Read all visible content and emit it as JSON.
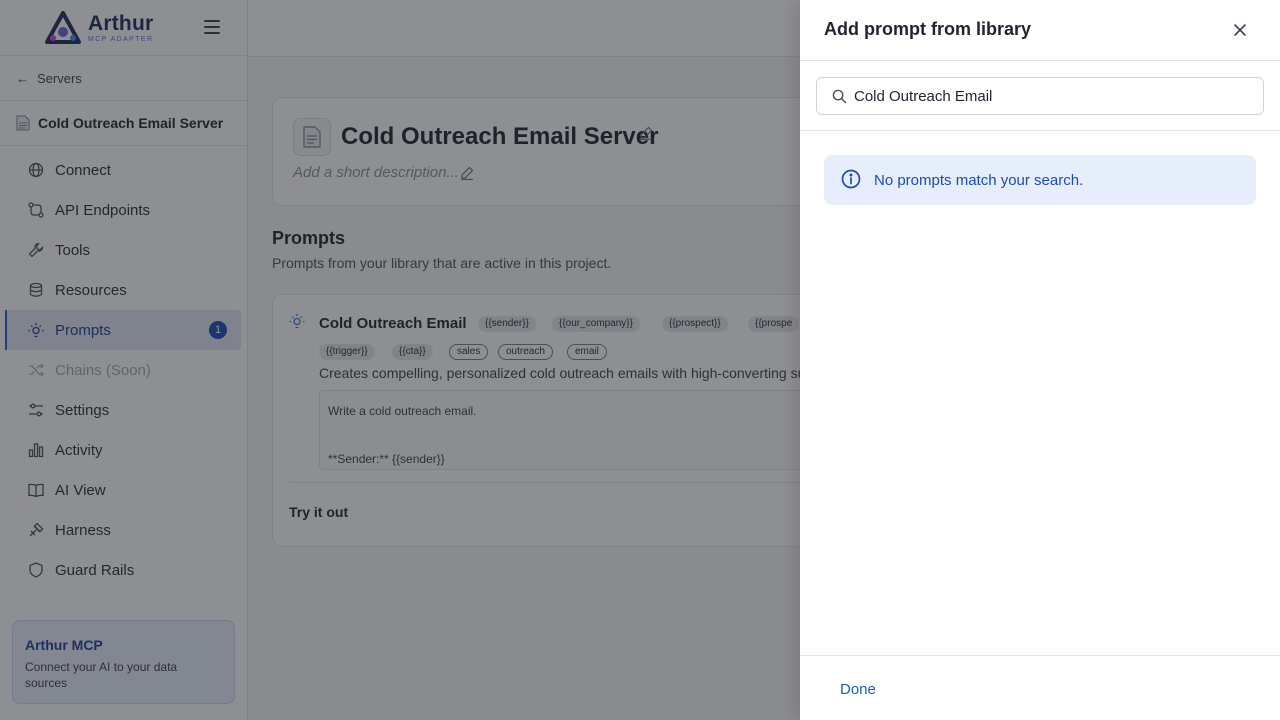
{
  "brand": {
    "name": "Arthur",
    "subtitle": "MCP ADAPTER",
    "accent": "#1e4bb8"
  },
  "sidebar": {
    "back_label": "Servers",
    "server_name": "Cold Outreach Email Server",
    "items": [
      {
        "label": "Connect",
        "icon": "globe-icon"
      },
      {
        "label": "API Endpoints",
        "icon": "endpoints-icon"
      },
      {
        "label": "Tools",
        "icon": "wrench-icon"
      },
      {
        "label": "Resources",
        "icon": "database-icon"
      },
      {
        "label": "Prompts",
        "icon": "bulb-icon",
        "badge": "1",
        "active": true
      },
      {
        "label": "Chains (Soon)",
        "icon": "shuffle-icon",
        "disabled": true
      },
      {
        "label": "Settings",
        "icon": "sliders-icon"
      },
      {
        "label": "Activity",
        "icon": "bar-chart-icon"
      },
      {
        "label": "AI View",
        "icon": "book-icon"
      },
      {
        "label": "Harness",
        "icon": "harness-icon"
      },
      {
        "label": "Guard Rails",
        "icon": "shield-icon"
      }
    ],
    "promo": {
      "title": "Arthur MCP",
      "text": "Connect your AI to your data sources"
    }
  },
  "main": {
    "server_title": "Cold Outreach Email Server",
    "description_placeholder": "Add a short description...",
    "section_title": "Prompts",
    "section_subtitle": "Prompts from your library that are active in this project.",
    "prompt": {
      "name": "Cold Outreach Email",
      "variables": [
        "{{sender}}",
        "{{our_company}}",
        "{{prospect}}",
        "{{prospe",
        "{{trigger}}",
        "{{cta}}"
      ],
      "tags": [
        "sales",
        "outreach",
        "email"
      ],
      "description": "Creates compelling, personalized cold outreach emails with high-converting su",
      "body_line1": "Write a cold outreach email.",
      "body_line2": "**Sender:** {{sender}}",
      "try_label": "Try it out"
    }
  },
  "drawer": {
    "title": "Add prompt from library",
    "search_value": "Cold Outreach Email",
    "empty_message": "No prompts match your search.",
    "done_label": "Done"
  }
}
